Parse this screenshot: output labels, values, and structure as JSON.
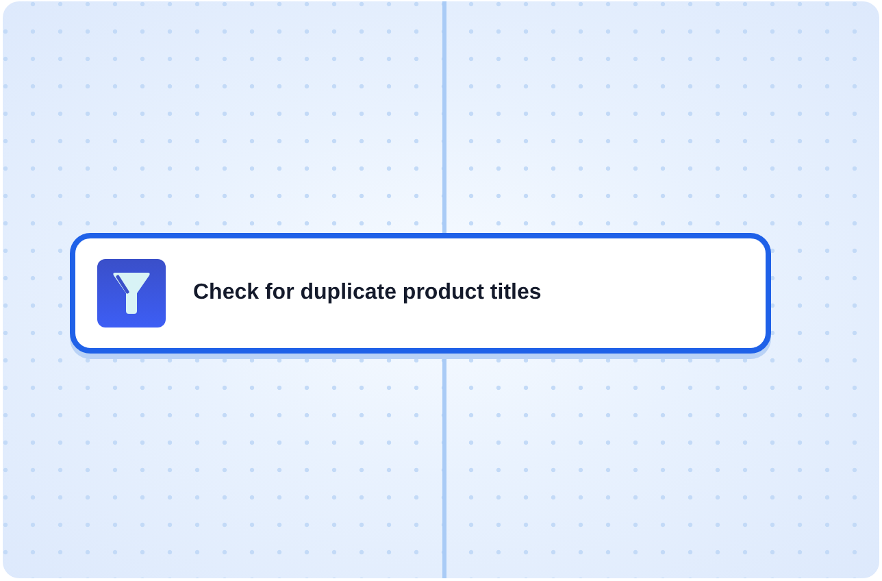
{
  "node": {
    "title": "Check for duplicate product titles"
  }
}
